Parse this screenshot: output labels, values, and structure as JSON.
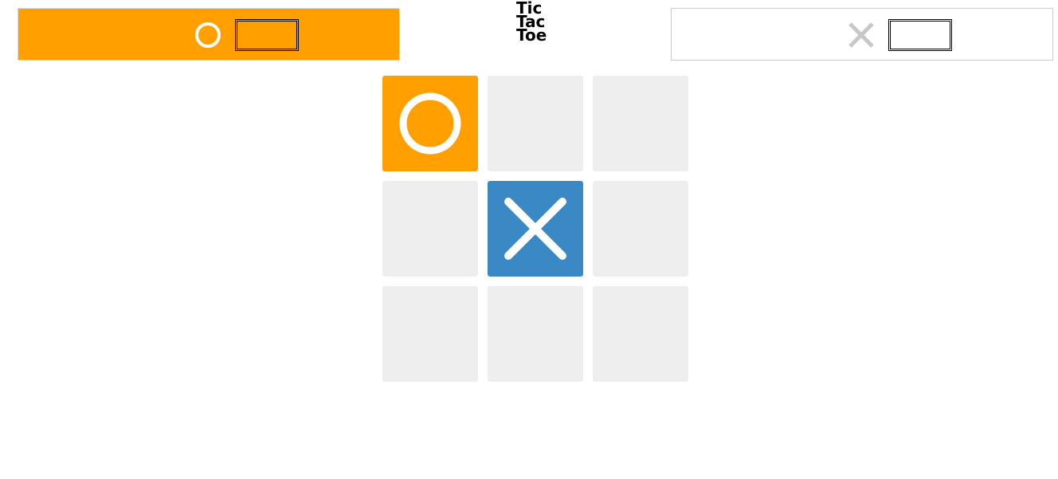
{
  "title": {
    "line1": "Tic",
    "line2": "Tac",
    "line3": "Toe"
  },
  "colors": {
    "o_accent": "#ffa000",
    "x_accent": "#3a89c4",
    "empty_cell": "#eeeeee",
    "inactive_icon": "#c8c8c8"
  },
  "players": {
    "o": {
      "icon": "circle-icon",
      "score": "",
      "active": true
    },
    "x": {
      "icon": "cross-icon",
      "score": "",
      "active": false
    }
  },
  "board": {
    "cells": [
      "O",
      "",
      "",
      "",
      "X",
      "",
      "",
      "",
      ""
    ]
  }
}
